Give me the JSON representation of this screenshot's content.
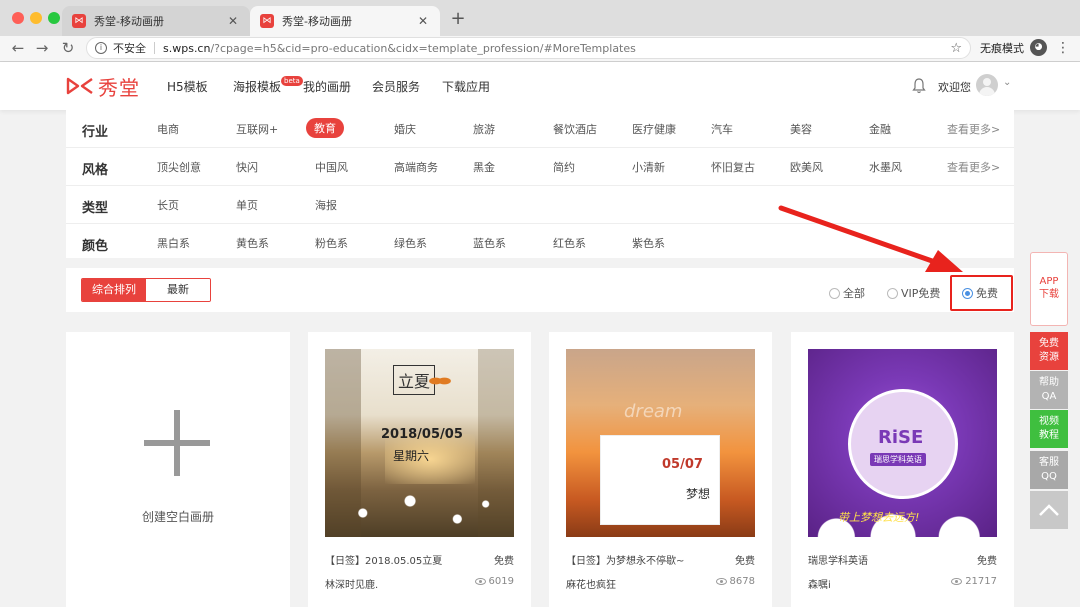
{
  "browser": {
    "tabs": [
      {
        "title": "秀堂-移动画册",
        "close": "✕"
      },
      {
        "title": "秀堂-移动画册",
        "close": "✕"
      }
    ],
    "new_tab": "+",
    "security_label": "不安全",
    "url_host": "s.wps.cn",
    "url_path": "/?cpage=h5&cid=pro-education&cidx=template_profession/#MoreTemplates",
    "incognito_label": "无痕模式"
  },
  "header": {
    "logo_text": "秀堂",
    "nav": [
      "H5模板",
      "海报模板",
      "我的画册",
      "会员服务",
      "下载应用"
    ],
    "beta_badge": "beta",
    "welcome": "欢迎您"
  },
  "filters": [
    {
      "label": "行业",
      "options": [
        "电商",
        "互联网+",
        "教育",
        "婚庆",
        "旅游",
        "餐饮酒店",
        "医疗健康",
        "汽车",
        "美容",
        "金融"
      ],
      "active": "教育",
      "more": "查看更多>"
    },
    {
      "label": "风格",
      "options": [
        "顶尖创意",
        "快闪",
        "中国风",
        "高端商务",
        "黑金",
        "简约",
        "小清新",
        "怀旧复古",
        "欧美风",
        "水墨风"
      ],
      "more": "查看更多>"
    },
    {
      "label": "类型",
      "options": [
        "长页",
        "单页",
        "海报"
      ]
    },
    {
      "label": "颜色",
      "options": [
        "黑白系",
        "黄色系",
        "粉色系",
        "绿色系",
        "蓝色系",
        "红色系",
        "紫色系"
      ]
    }
  ],
  "sort": {
    "buttons": [
      "综合排列",
      "最新"
    ],
    "price_options": [
      "全部",
      "VIP免费",
      "免费"
    ],
    "selected_price": "免费"
  },
  "blank_card": {
    "label": "创建空白画册"
  },
  "cards": [
    {
      "title": "【日签】2018.05.05立夏",
      "badge": "免费",
      "author": "林深时见鹿.",
      "views": "6019",
      "thumb_text": {
        "main": "2018/05/05",
        "sub": "星期六",
        "char": "立夏"
      }
    },
    {
      "title": "【日签】为梦想永不停歇~",
      "badge": "免费",
      "author": "麻花也疯狂",
      "views": "8678",
      "thumb_text": {
        "dream": "dream",
        "date": "05/07",
        "dream_cn": "梦想"
      }
    },
    {
      "title": "瑞思学科英语",
      "badge": "免费",
      "author": "森嘱i",
      "views": "21717",
      "thumb_text": {
        "rise": "RiSE",
        "rise_cn": "瑞思学科英语",
        "slogan": "带上梦想去远方!"
      }
    }
  ],
  "side": {
    "app": "APP\n下载",
    "buttons": [
      {
        "line1": "免费",
        "line2": "资源"
      },
      {
        "line1": "帮助",
        "line2": "QA"
      },
      {
        "line1": "视频",
        "line2": "教程"
      },
      {
        "line1": "客服",
        "line2": "QQ"
      }
    ]
  },
  "colors": {
    "brand": "#e8423d",
    "radio_checked": "#4a90e2",
    "annotation": "#e8231d"
  }
}
